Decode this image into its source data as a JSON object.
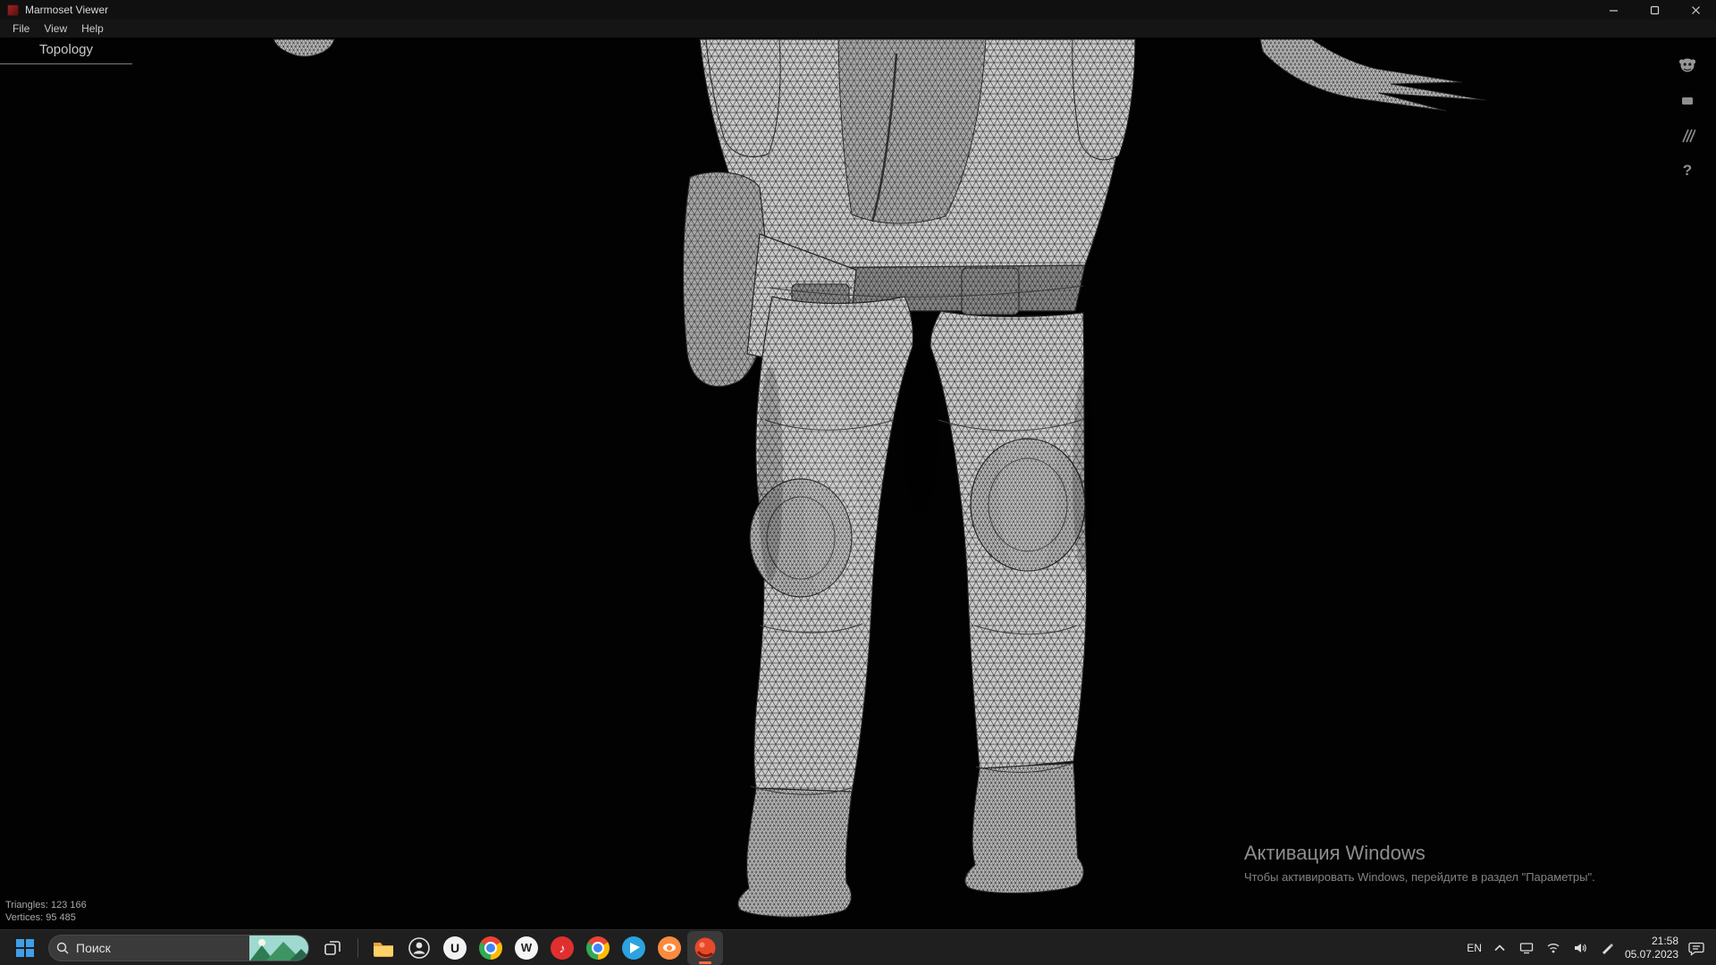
{
  "window": {
    "title": "Marmoset Viewer",
    "app_icon": "marmoset-viewer-icon",
    "controls": [
      "minimize",
      "maximize",
      "close"
    ]
  },
  "menu": {
    "items": [
      {
        "label": "File"
      },
      {
        "label": "View"
      },
      {
        "label": "Help"
      }
    ]
  },
  "viewer": {
    "tab": {
      "label": "Topology"
    },
    "side_toolbar": [
      {
        "icon": "marmoset-logo-icon"
      },
      {
        "icon": "material-view-icon"
      },
      {
        "icon": "wireframe-view-icon"
      },
      {
        "icon": "help-icon",
        "glyph": "?"
      }
    ],
    "stats": {
      "triangles": "Triangles: 123 166",
      "vertices": "Vertices: 95 485"
    }
  },
  "watermark": {
    "title": "Активация Windows",
    "subtitle": "Чтобы активировать Windows, перейдите в раздел \"Параметры\"."
  },
  "taskbar": {
    "start": {
      "icon": "windows-start-icon"
    },
    "search": {
      "placeholder": "Поиск",
      "icon": "search-icon"
    },
    "task_view": {
      "icon": "task-view-icon"
    },
    "apps": [
      {
        "name": "file-explorer"
      },
      {
        "name": "people-app"
      },
      {
        "name": "unreal-engine",
        "letter": "U"
      },
      {
        "name": "chrome"
      },
      {
        "name": "w-app",
        "letter": "W"
      },
      {
        "name": "music-app",
        "glyph": "♪"
      },
      {
        "name": "chrome-2"
      },
      {
        "name": "telegram"
      },
      {
        "name": "blender"
      },
      {
        "name": "marmoset-toolbag",
        "active": true
      }
    ],
    "tray": {
      "language": "EN",
      "time": "21:58",
      "date": "05.07.2023"
    }
  }
}
